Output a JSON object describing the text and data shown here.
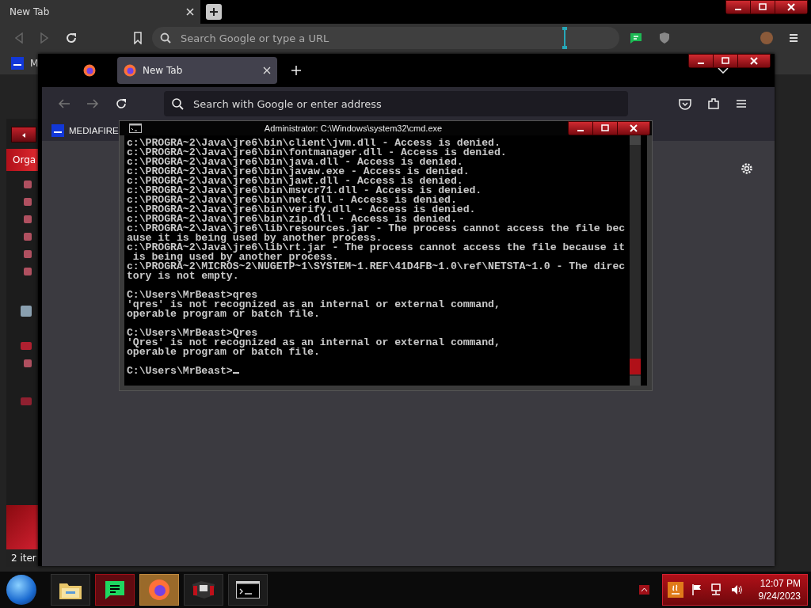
{
  "chrome": {
    "tab": {
      "title": "New Tab",
      "selected": true
    },
    "omnibox": {
      "placeholder": "Search Google or type a URL"
    },
    "bookmark": {
      "label": "M"
    }
  },
  "explorer": {
    "toolbar_button": "Orga",
    "status": "2 iter"
  },
  "firefox": {
    "tabs": [
      {
        "title": "New Tab",
        "selected": true
      }
    ],
    "address": {
      "placeholder": "Search with Google or enter address"
    },
    "bookmark": {
      "label": "MEDIAFIRE"
    }
  },
  "cmd": {
    "title": "Administrator: C:\\Windows\\system32\\cmd.exe",
    "blocks": [
      [
        "c:\\PROGRA~2\\Java\\jre6\\bin\\client\\jvm.dll - Access is denied.",
        "c:\\PROGRA~2\\Java\\jre6\\bin\\fontmanager.dll - Access is denied.",
        "c:\\PROGRA~2\\Java\\jre6\\bin\\java.dll - Access is denied.",
        "c:\\PROGRA~2\\Java\\jre6\\bin\\javaw.exe - Access is denied.",
        "c:\\PROGRA~2\\Java\\jre6\\bin\\jawt.dll - Access is denied.",
        "c:\\PROGRA~2\\Java\\jre6\\bin\\msvcr71.dll - Access is denied.",
        "c:\\PROGRA~2\\Java\\jre6\\bin\\net.dll - Access is denied.",
        "c:\\PROGRA~2\\Java\\jre6\\bin\\verify.dll - Access is denied.",
        "c:\\PROGRA~2\\Java\\jre6\\bin\\zip.dll - Access is denied.",
        "c:\\PROGRA~2\\Java\\jre6\\lib\\resources.jar - The process cannot access the file bec",
        "ause it is being used by another process.",
        "c:\\PROGRA~2\\Java\\jre6\\lib\\rt.jar - The process cannot access the file because it",
        " is being used by another process.",
        "c:\\PROGRA~2\\MICROS~2\\NUGETP~1\\SYSTEM~1.REF\\41D4FB~1.0\\ref\\NETSTA~1.0 - The direc",
        "tory is not empty."
      ],
      [
        "C:\\Users\\MrBeast>qres",
        "'qres' is not recognized as an internal or external command,",
        "operable program or batch file."
      ],
      [
        "C:\\Users\\MrBeast>Qres",
        "'Qres' is not recognized as an internal or external command,",
        "operable program or batch file."
      ],
      [
        "C:\\Users\\MrBeast>"
      ]
    ],
    "cursor": true
  },
  "taskbar": {
    "buttons": [
      {
        "kind": "folder",
        "selected": false,
        "attention": false
      },
      {
        "kind": "spotify",
        "selected": false,
        "attention": true
      },
      {
        "kind": "firefox",
        "selected": true,
        "attention": false
      },
      {
        "kind": "game",
        "selected": false,
        "attention": false
      },
      {
        "kind": "terminal",
        "selected": false,
        "attention": false
      }
    ],
    "clock": {
      "time": "12:07 PM",
      "date": "9/24/2023"
    }
  }
}
